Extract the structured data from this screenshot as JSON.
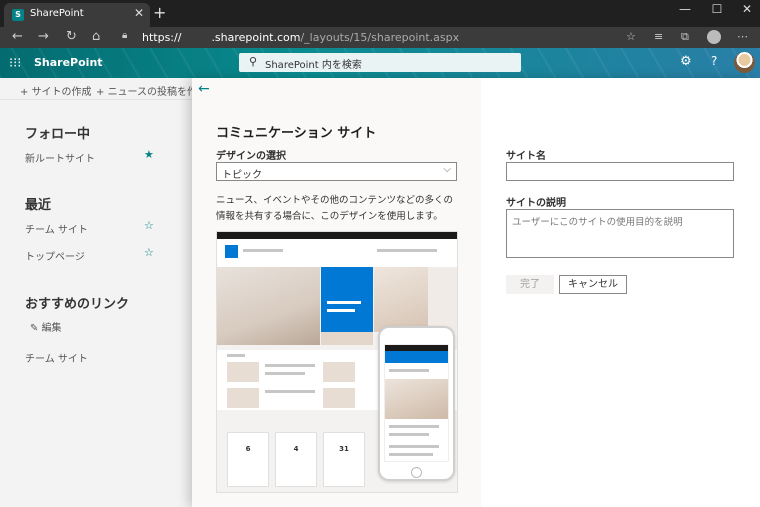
{
  "browser": {
    "tab_title": "SharePoint",
    "tab_close": "✕",
    "new_tab": "+",
    "url_scheme": "https://",
    "url_host": ".sharepoint.com",
    "url_path": "/_layouts/15/sharepoint.aspx"
  },
  "suitebar": {
    "app_name": "SharePoint",
    "search_placeholder": "SharePoint 内を検索"
  },
  "commandbar": {
    "create_site": "サイトの作成",
    "create_news": "ニュースの投稿を作成"
  },
  "leftnav": {
    "following_heading": "フォロー中",
    "following_items": [
      "新ルートサイト"
    ],
    "recent_heading": "最近",
    "recent_items": [
      "チーム サイト",
      "トップページ"
    ],
    "featured_heading": "おすすめのリンク",
    "edit_label": "編集",
    "featured_items": [
      "チーム サイト"
    ]
  },
  "panel": {
    "title": "コミュニケーション サイト",
    "design_label": "デザインの選択",
    "design_value": "トピック",
    "description": "ニュース、イベントやその他のコンテンツなどの多くの情報を共有する場合に、このデザインを使用します。",
    "site_name_label": "サイト名",
    "site_name_value": "",
    "site_desc_label": "サイトの説明",
    "site_desc_placeholder": "ユーザーにこのサイトの使用目的を説明",
    "done_button": "完了",
    "cancel_button": "キャンセル"
  },
  "preview": {
    "event_days": [
      "6",
      "4",
      "31"
    ]
  },
  "colors": {
    "accent": "#038387",
    "brand_blue": "#0078d4"
  }
}
